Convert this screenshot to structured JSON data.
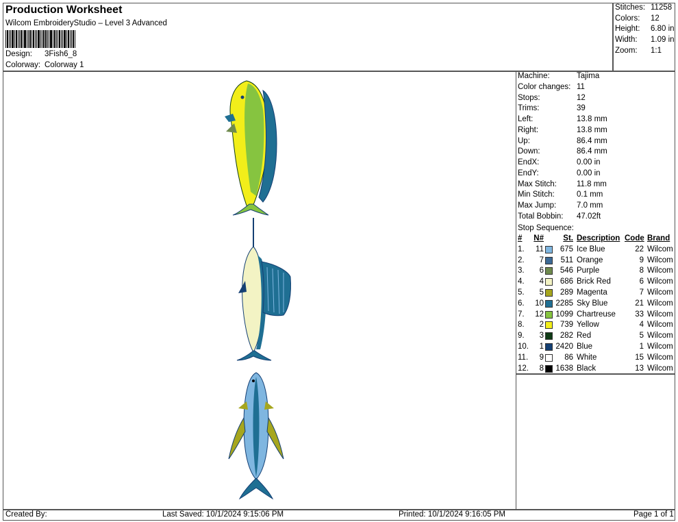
{
  "header": {
    "title": "Production Worksheet",
    "software": "Wilcom EmbroideryStudio – Level 3 Advanced",
    "design_label": "Design:",
    "design_value": "3Fish6_8",
    "colorway_label": "Colorway:",
    "colorway_value": "Colorway 1"
  },
  "summary": [
    {
      "label": "Stitches:",
      "value": "11258"
    },
    {
      "label": "Colors:",
      "value": "12"
    },
    {
      "label": "Height:",
      "value": "6.80 in"
    },
    {
      "label": "Width:",
      "value": "1.09 in"
    },
    {
      "label": "Zoom:",
      "value": "1:1"
    }
  ],
  "machine_info": [
    {
      "label": "Machine:",
      "value": "Tajima"
    },
    {
      "label": "Color changes:",
      "value": "11"
    },
    {
      "label": "Stops:",
      "value": "12"
    },
    {
      "label": "Trims:",
      "value": "39"
    },
    {
      "label": "Left:",
      "value": "13.8 mm"
    },
    {
      "label": "Right:",
      "value": "13.8 mm"
    },
    {
      "label": "Up:",
      "value": "86.4 mm"
    },
    {
      "label": "Down:",
      "value": "86.4 mm"
    },
    {
      "label": "EndX:",
      "value": "0.00 in"
    },
    {
      "label": "EndY:",
      "value": "0.00 in"
    },
    {
      "label": "Max Stitch:",
      "value": "11.8 mm"
    },
    {
      "label": "Min Stitch:",
      "value": "0.1 mm"
    },
    {
      "label": "Max Jump:",
      "value": "7.0 mm"
    },
    {
      "label": "Total Bobbin:",
      "value": "47.02ft"
    }
  ],
  "stop_sequence": {
    "title": "Stop Sequence:",
    "headers": {
      "idx": "#",
      "n": "N#",
      "st": "St.",
      "desc": "Description",
      "code": "Code",
      "brand": "Brand"
    },
    "rows": [
      {
        "idx": "1.",
        "n": "11",
        "color": "#7fb6e0",
        "st": "675",
        "desc": "Ice Blue",
        "code": "22",
        "brand": "Wilcom"
      },
      {
        "idx": "2.",
        "n": "7",
        "color": "#3d6a96",
        "st": "511",
        "desc": "Orange",
        "code": "9",
        "brand": "Wilcom"
      },
      {
        "idx": "3.",
        "n": "6",
        "color": "#6f8a4e",
        "st": "546",
        "desc": "Purple",
        "code": "8",
        "brand": "Wilcom"
      },
      {
        "idx": "4.",
        "n": "4",
        "color": "#f3f3c4",
        "st": "686",
        "desc": "Brick Red",
        "code": "6",
        "brand": "Wilcom"
      },
      {
        "idx": "5.",
        "n": "5",
        "color": "#a6a61e",
        "st": "289",
        "desc": "Magenta",
        "code": "7",
        "brand": "Wilcom"
      },
      {
        "idx": "6.",
        "n": "10",
        "color": "#1f6f93",
        "st": "2285",
        "desc": "Sky Blue",
        "code": "21",
        "brand": "Wilcom"
      },
      {
        "idx": "7.",
        "n": "12",
        "color": "#86c440",
        "st": "1099",
        "desc": "Chartreuse",
        "code": "33",
        "brand": "Wilcom"
      },
      {
        "idx": "8.",
        "n": "2",
        "color": "#f2ee1a",
        "st": "739",
        "desc": "Yellow",
        "code": "4",
        "brand": "Wilcom"
      },
      {
        "idx": "9.",
        "n": "3",
        "color": "#0f3b16",
        "st": "282",
        "desc": "Red",
        "code": "5",
        "brand": "Wilcom"
      },
      {
        "idx": "10.",
        "n": "1",
        "color": "#143f73",
        "st": "2420",
        "desc": "Blue",
        "code": "1",
        "brand": "Wilcom"
      },
      {
        "idx": "11.",
        "n": "9",
        "color": "#ffffff",
        "st": "86",
        "desc": "White",
        "code": "15",
        "brand": "Wilcom"
      },
      {
        "idx": "12.",
        "n": "8",
        "color": "#000000",
        "st": "1638",
        "desc": "Black",
        "code": "13",
        "brand": "Wilcom"
      }
    ]
  },
  "footer": {
    "created_by": "Created By:",
    "last_saved": "Last Saved: 10/1/2024 9:15:06 PM",
    "printed": "Printed: 10/1/2024 9:16:05 PM",
    "page": "Page 1 of 1"
  },
  "design_preview": {
    "fish": [
      "mahi-mahi",
      "sailfish",
      "tuna"
    ],
    "colors": {
      "yellow": "#f2ee1a",
      "chartreuse": "#86c440",
      "sky_blue": "#1f6f93",
      "blue": "#143f73",
      "ice_blue": "#7fb6e0",
      "cream": "#f3f3c4",
      "olive": "#a6a61e",
      "dark_green": "#0f3b16"
    }
  }
}
